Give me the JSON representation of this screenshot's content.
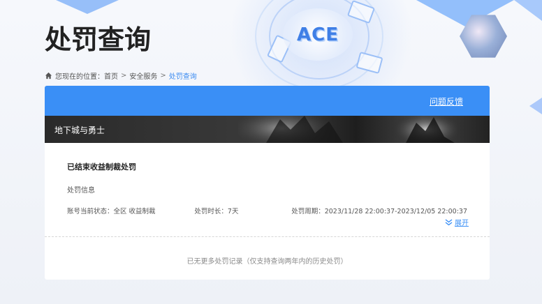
{
  "page": {
    "title": "处罚查询"
  },
  "brand": {
    "logo_text": "ACE",
    "accent_color": "#3a8ff6"
  },
  "breadcrumb": {
    "prefix": "您现在的位置：",
    "items": [
      "首页",
      "安全服务",
      "处罚查询"
    ],
    "separator": ">"
  },
  "panel": {
    "feedback_label": "问题反馈",
    "game_name": "地下城与勇士",
    "penalty": {
      "status_title": "已结束收益制裁处罚",
      "info_title": "处罚信息",
      "account_status": "账号当前状态：全区 收益制裁",
      "duration": "处罚时长：7天",
      "period": "处罚周期：2023/11/28 22:00:37-2023/12/05 22:00:37",
      "expand_label": "展开"
    },
    "no_more_text": "已无更多处罚记录（仅支持查询两年内的历史处罚）"
  },
  "icons": {
    "home": "home-icon",
    "expand": "double-chevron-down-icon"
  }
}
